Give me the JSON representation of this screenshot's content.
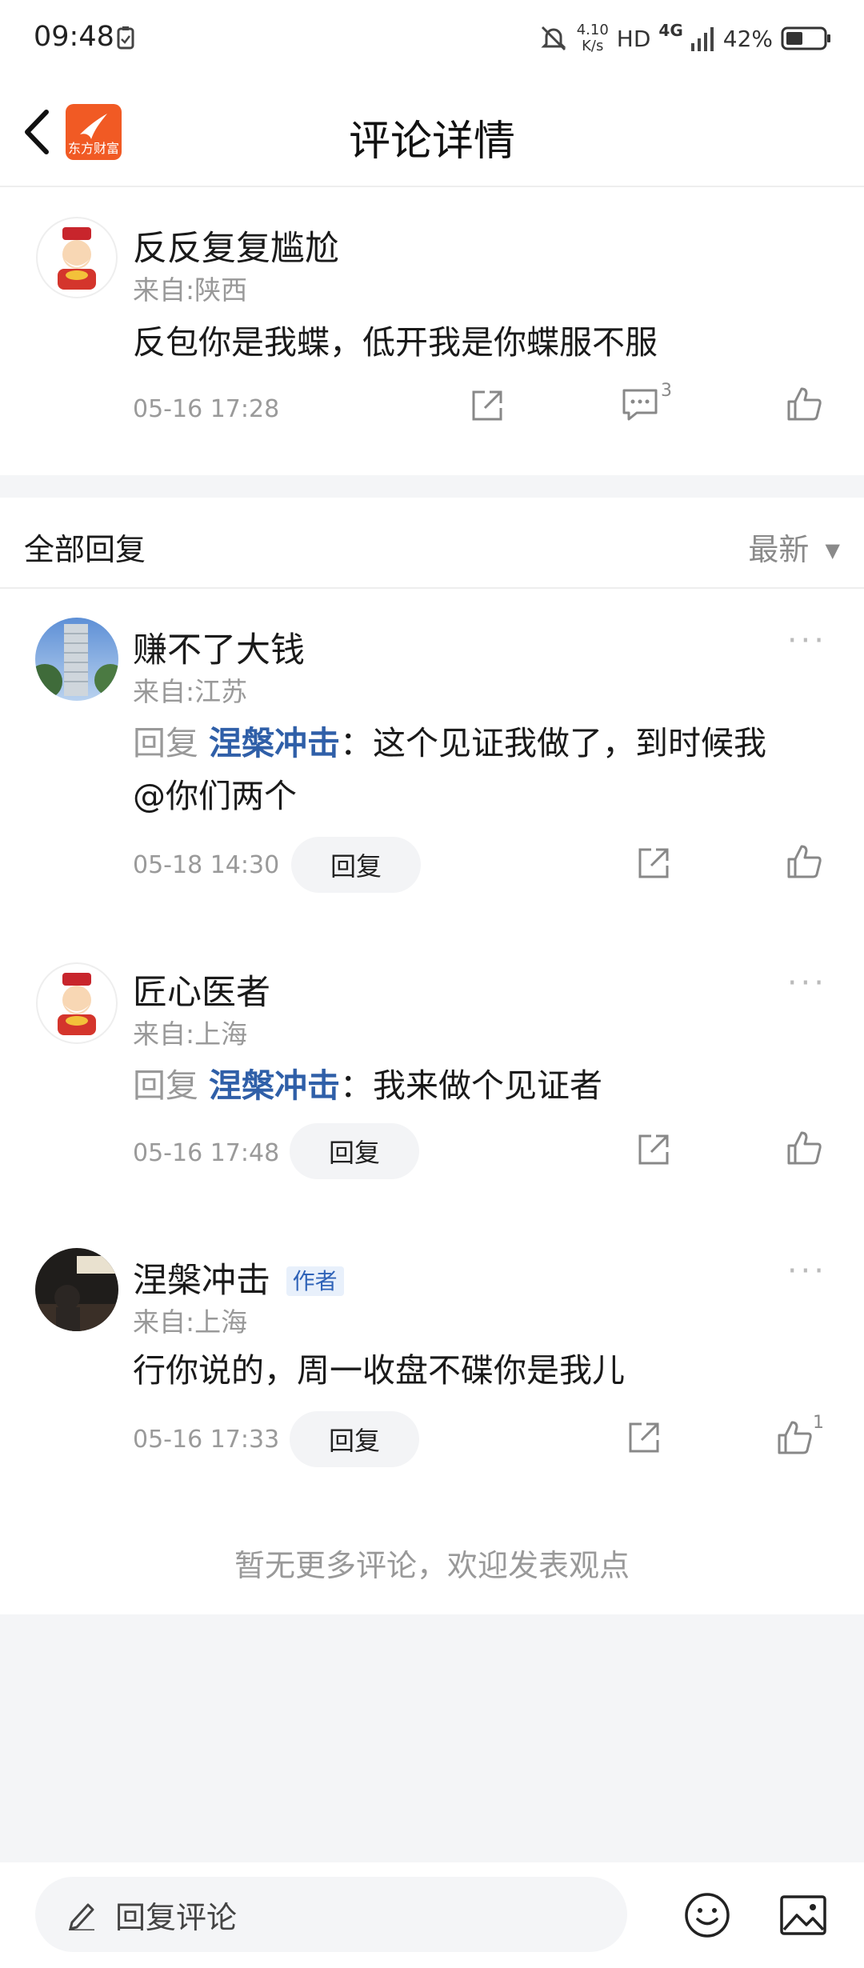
{
  "status_bar": {
    "time": "09:48",
    "net_speed_value": "4.10",
    "net_speed_unit": "K/s",
    "hd": "HD",
    "network": "4G",
    "battery": "42%"
  },
  "header": {
    "title": "评论详情",
    "app_logo_text": "东方财富"
  },
  "main_comment": {
    "user": "反反复复尴尬",
    "region": "来自:陕西",
    "text": "反包你是我蝶，低开我是你蝶服不服",
    "time": "05-16 17:28",
    "comment_count": "3"
  },
  "replies_section": {
    "title": "全部回复",
    "sort_label": "最新"
  },
  "replies": [
    {
      "user": "赚不了大钱",
      "region": "来自:江苏",
      "prefix": "回复",
      "mention": "涅槃冲击",
      "separator": "：",
      "text": "这个见证我做了，到时候我",
      "text_cont": "@你们两个",
      "time": "05-18 14:30",
      "reply_label": "回复"
    },
    {
      "user": "匠心医者",
      "region": "来自:上海",
      "prefix": "回复",
      "mention": "涅槃冲击",
      "separator": "：",
      "text": "我来做个见证者",
      "time": "05-16 17:48",
      "reply_label": "回复"
    },
    {
      "user": "涅槃冲击",
      "badge": "作者",
      "region": "来自:上海",
      "text": "行你说的，周一收盘不碟你是我儿",
      "time": "05-16 17:33",
      "reply_label": "回复",
      "like_count": "1"
    }
  ],
  "footer_note": "暂无更多评论，欢迎发表观点",
  "bottom_bar": {
    "input_placeholder": "回复评论"
  },
  "colors": {
    "mention": "#2f5fa8",
    "logo": "#f15a24",
    "band": "#f4f5f7"
  }
}
